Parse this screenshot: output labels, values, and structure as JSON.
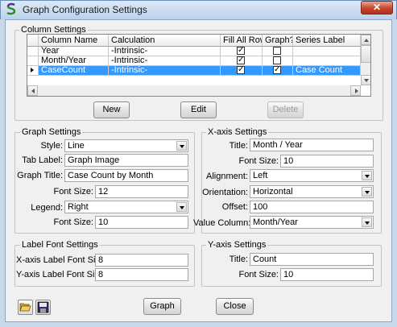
{
  "window": {
    "title": "Graph Configuration Settings",
    "close_glyph": "✕",
    "app_icon": "s-logo-icon",
    "close_color": "#c7452d"
  },
  "column_settings": {
    "label": "Column Settings",
    "headers": [
      "Column Name",
      "Calculation",
      "Fill All Rows",
      "Graph?",
      "Series Label"
    ],
    "rows": [
      {
        "name": "Year",
        "calculation": "-Intrinsic-",
        "fill_all_rows": true,
        "graph": false,
        "series_label": ""
      },
      {
        "name": "Month/Year",
        "calculation": "-Intrinsic-",
        "fill_all_rows": true,
        "graph": false,
        "series_label": ""
      },
      {
        "name": "CaseCount",
        "calculation": "-Intrinsic-",
        "fill_all_rows": true,
        "graph": true,
        "series_label": "Case Count",
        "selected": true
      }
    ],
    "selection_color": "#3399ff",
    "buttons": {
      "new_label": "New",
      "edit_label": "Edit",
      "delete_label": "Delete"
    }
  },
  "graph_settings": {
    "label": "Graph Settings",
    "style_label": "Style:",
    "style_value": "Line",
    "tab_label_label": "Tab Label:",
    "tab_label_value": "Graph Image",
    "graph_title_label": "Graph Title:",
    "graph_title_value": "Case Count by Month",
    "font_size_label": "Font Size:",
    "font_size_value": "12",
    "legend_label": "Legend:",
    "legend_value": "Right",
    "legend_font_size_label": "Font Size:",
    "legend_font_size_value": "10"
  },
  "xaxis_settings": {
    "label": "X-axis Settings",
    "title_label": "Title:",
    "title_value": "Month / Year",
    "font_size_label": "Font Size:",
    "font_size_value": "10",
    "alignment_label": "Alignment:",
    "alignment_value": "Left",
    "orientation_label": "Orientation:",
    "orientation_value": "Horizontal",
    "offset_label": "Offset:",
    "offset_value": "100",
    "value_column_label": "Value Column:",
    "value_column_value": "Month/Year"
  },
  "label_font_settings": {
    "label": "Label Font Settings",
    "xaxis_label": "X-axis Label Font Size:",
    "xaxis_value": "8",
    "yaxis_label": "Y-axis Label Font Size:",
    "yaxis_value": "8"
  },
  "yaxis_settings": {
    "label": "Y-axis Settings",
    "title_label": "Title:",
    "title_value": "Count",
    "font_size_label": "Font Size:",
    "font_size_value": "10"
  },
  "footer": {
    "open_icon": "folder-open-icon",
    "save_icon": "floppy-disk-icon",
    "graph_label": "Graph",
    "close_label": "Close"
  }
}
